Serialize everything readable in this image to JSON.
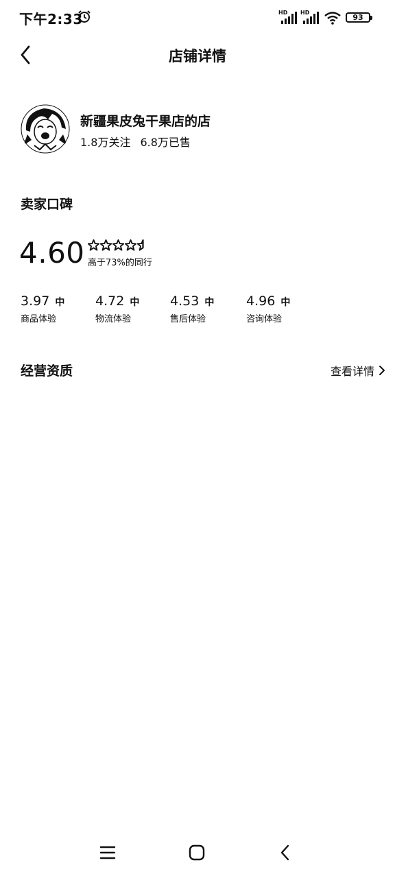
{
  "status_bar": {
    "time": "下午2:33",
    "signal_badge_1": "HD",
    "signal_badge_2": "HD",
    "battery": "93",
    "icons": [
      "alarm-icon",
      "signal-icon",
      "signal-icon",
      "wifi-icon",
      "battery-icon"
    ]
  },
  "header": {
    "title": "店铺详情",
    "back_icon": "chevron-left-icon"
  },
  "shop": {
    "name": "新疆果皮兔干果店的店",
    "followers": "1.8万关注",
    "sold": "6.8万已售"
  },
  "reputation": {
    "title": "卖家口碑",
    "score": "4.60",
    "stars": 4.6,
    "compare_text": "高于73%的同行",
    "metrics": [
      {
        "value": "3.97",
        "level": "中",
        "label": "商品体验"
      },
      {
        "value": "4.72",
        "level": "中",
        "label": "物流体验"
      },
      {
        "value": "4.53",
        "level": "中",
        "label": "售后体验"
      },
      {
        "value": "4.96",
        "level": "中",
        "label": "咨询体验"
      }
    ]
  },
  "qualification": {
    "title": "经营资质",
    "link_label": "查看详情"
  },
  "nav": {
    "icons": [
      "menu-icon",
      "home-icon",
      "back-icon"
    ]
  }
}
